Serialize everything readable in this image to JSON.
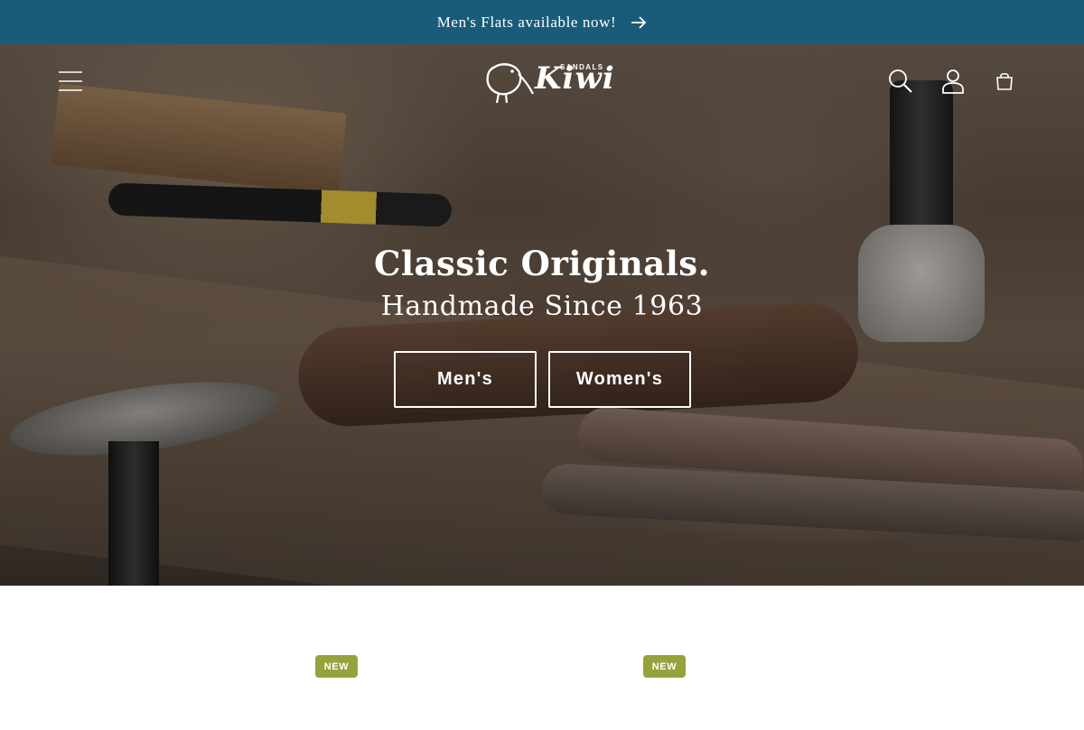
{
  "announcement": {
    "text": "Men's Flats available now!",
    "arrow_icon": "arrow-right-icon",
    "background": "#1a5b7a"
  },
  "header": {
    "menu_icon": "hamburger-menu-icon",
    "logo": {
      "brand": "Kiwi",
      "tagline": "SANDALS"
    },
    "search_icon": "search-icon",
    "account_icon": "user-icon",
    "cart_icon": "shopping-bag-icon"
  },
  "hero": {
    "title": "Classic Originals.",
    "subtitle": "Handmade Since 1963",
    "buttons": [
      {
        "label": "Men's"
      },
      {
        "label": "Women's"
      }
    ]
  },
  "products": {
    "badges": [
      "NEW",
      "NEW"
    ],
    "badge_color": "#96a33c"
  }
}
